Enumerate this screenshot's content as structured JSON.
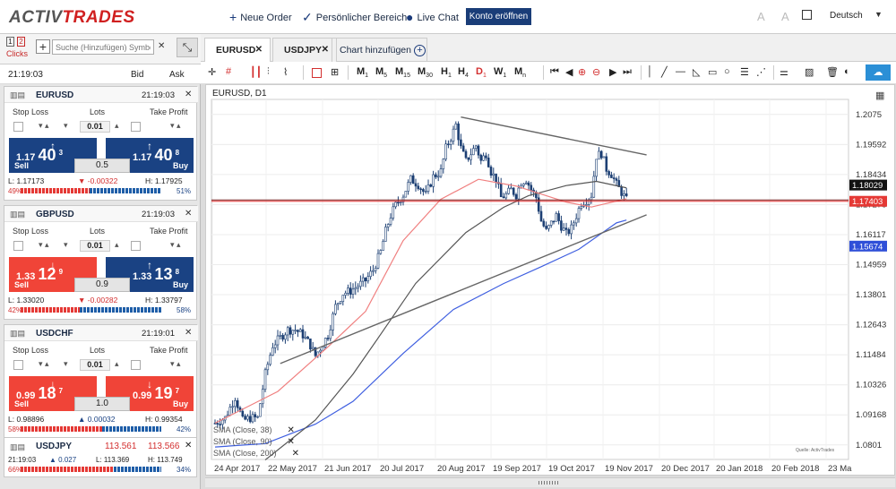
{
  "topbar": {
    "logo_main": "ACTIV",
    "logo_accent": "TRADES",
    "new_order": "Neue Order",
    "personal_area": "Persönlicher Bereich",
    "live_chat": "Live Chat",
    "open_account": "Konto eröffnen",
    "language": "Deutsch"
  },
  "left": {
    "clicks_one": "1",
    "clicks_two": "2",
    "clicks_label": "Clicks",
    "search_placeholder": "Suche (Hinzufügen) Symbol",
    "time": "21:19:03",
    "bid_label": "Bid",
    "ask_label": "Ask",
    "labels": {
      "stop_loss": "Stop Loss",
      "lots": "Lots",
      "take_profit": "Take Profit",
      "sell": "Sell",
      "buy": "Buy"
    },
    "pairs": [
      {
        "name": "EURUSD",
        "time": "21:19:03",
        "lots": "0.01",
        "sell_a": "1.17",
        "sell_b": "40",
        "sell_c": "3",
        "buy_a": "1.17",
        "buy_b": "40",
        "buy_c": "8",
        "spread": "0.5",
        "low": "L: 1.17173",
        "change": "-0.00322",
        "high": "H: 1.17925",
        "pct_sell": "49%",
        "pct_buy": "51%",
        "sell_fraction": 0.49,
        "sell_color": "blue",
        "buy_color": "blue",
        "sell_arrow": "↑",
        "buy_arrow": "↑",
        "change_dir": "down"
      },
      {
        "name": "GBPUSD",
        "time": "21:19:03",
        "lots": "0.01",
        "sell_a": "1.33",
        "sell_b": "12",
        "sell_c": "9",
        "buy_a": "1.33",
        "buy_b": "13",
        "buy_c": "8",
        "spread": "0.9",
        "low": "L: 1.33020",
        "change": "-0.00282",
        "high": "H: 1.33797",
        "pct_sell": "42%",
        "pct_buy": "58%",
        "sell_fraction": 0.42,
        "sell_color": "red",
        "buy_color": "blue",
        "sell_arrow": "↓",
        "buy_arrow": "↑",
        "change_dir": "down"
      },
      {
        "name": "USDCHF",
        "time": "21:19:01",
        "lots": "0.01",
        "sell_a": "0.99",
        "sell_b": "18",
        "sell_c": "7",
        "buy_a": "0.99",
        "buy_b": "19",
        "buy_c": "7",
        "spread": "1.0",
        "low": "L: 0.98896",
        "change": "0.00032",
        "high": "H: 0.99354",
        "pct_sell": "58%",
        "pct_buy": "42%",
        "sell_fraction": 0.58,
        "sell_color": "red",
        "buy_color": "red",
        "sell_arrow": "↓",
        "buy_arrow": "↓",
        "change_dir": "up"
      }
    ],
    "usdjpy": {
      "name": "USDJPY",
      "bid": "113.561",
      "ask": "113.566",
      "time": "21:19:03",
      "change": "0.027",
      "low": "L: 113.369",
      "high": "H: 113.749",
      "pct_sell": "66%",
      "pct_buy": "34%",
      "sell_fraction": 0.66
    }
  },
  "tabs": [
    {
      "label": "EURUSD",
      "active": true
    },
    {
      "label": "USDJPY",
      "active": false
    }
  ],
  "tab_add_label": "Chart hinzufügen",
  "toolbar": {
    "timeframes": [
      {
        "base": "M",
        "sub": "1"
      },
      {
        "base": "M",
        "sub": "5"
      },
      {
        "base": "M",
        "sub": "15"
      },
      {
        "base": "M",
        "sub": "30"
      },
      {
        "base": "H",
        "sub": "1"
      },
      {
        "base": "H",
        "sub": "4"
      },
      {
        "base": "D",
        "sub": "1"
      },
      {
        "base": "W",
        "sub": "1"
      },
      {
        "base": "M",
        "sub": "n"
      }
    ],
    "active_timeframe": "D1"
  },
  "chart": {
    "title": "EURUSD, D1",
    "indicator_labels": [
      "SMA (Close, 38)",
      "SMA (Close, 90)",
      "SMA (Close, 200)"
    ],
    "source_label": "Quelle: ActivTrades",
    "bid_tag": "1.18029",
    "ask_tag": "1.17403",
    "sma200_tag": "1.15674",
    "colors": {
      "up": "#1c3f73",
      "down": "#1c3f73",
      "sma38": "#f08080",
      "sma90": "#555555",
      "sma200": "#3f5fe0",
      "bid_line": "#7a2020",
      "ask_line": "#e03030"
    }
  },
  "chart_data": {
    "type": "candlestick",
    "symbol": "EURUSD",
    "timeframe": "D1",
    "yticks": [
      1.2075,
      1.19592,
      1.18434,
      1.17276,
      1.16117,
      1.14959,
      1.13801,
      1.12643,
      1.11484,
      1.10326,
      1.09168,
      1.0801
    ],
    "ylim": [
      1.0745,
      1.2133
    ],
    "xticks": [
      "24 Apr 2017",
      "22 May 2017",
      "21 Jun 2017",
      "20 Jul 2017",
      "20 Aug 2017",
      "19 Sep 2017",
      "19 Oct 2017",
      "19 Nov 2017",
      "20 Dec 2017",
      "20 Jan 2018",
      "20 Feb 2018",
      "23 Ma"
    ],
    "close_path": [
      [
        0,
        1.0885
      ],
      [
        4,
        1.0905
      ],
      [
        8,
        1.0985
      ],
      [
        11,
        1.0895
      ],
      [
        14,
        1.0905
      ],
      [
        17,
        1.0905
      ],
      [
        20,
        1.1075
      ],
      [
        23,
        1.1185
      ],
      [
        26,
        1.1215
      ],
      [
        29,
        1.1245
      ],
      [
        32,
        1.1245
      ],
      [
        35,
        1.1225
      ],
      [
        38,
        1.1185
      ],
      [
        40,
        1.1145
      ],
      [
        42,
        1.1175
      ],
      [
        45,
        1.1225
      ],
      [
        48,
        1.1335
      ],
      [
        51,
        1.1385
      ],
      [
        54,
        1.1395
      ],
      [
        57,
        1.1415
      ],
      [
        60,
        1.1435
      ],
      [
        63,
        1.1475
      ],
      [
        66,
        1.1545
      ],
      [
        68,
        1.1625
      ],
      [
        70,
        1.1685
      ],
      [
        72,
        1.1725
      ],
      [
        75,
        1.1765
      ],
      [
        78,
        1.1825
      ],
      [
        81,
        1.1805
      ],
      [
        84,
        1.1765
      ],
      [
        87,
        1.1835
      ],
      [
        90,
        1.1855
      ],
      [
        92,
        1.1945
      ],
      [
        94,
        1.1985
      ],
      [
        96,
        1.2035
      ],
      [
        98,
        1.1945
      ],
      [
        100,
        1.1895
      ],
      [
        102,
        1.1925
      ],
      [
        104,
        1.1955
      ],
      [
        106,
        1.1895
      ],
      [
        108,
        1.1925
      ],
      [
        110,
        1.1855
      ],
      [
        112,
        1.1825
      ],
      [
        114,
        1.1755
      ],
      [
        116,
        1.1765
      ],
      [
        118,
        1.1785
      ],
      [
        120,
        1.1765
      ],
      [
        122,
        1.1815
      ],
      [
        124,
        1.1825
      ],
      [
        126,
        1.1785
      ],
      [
        128,
        1.1755
      ],
      [
        130,
        1.1665
      ],
      [
        132,
        1.1625
      ],
      [
        134,
        1.1655
      ],
      [
        136,
        1.1685
      ],
      [
        138,
        1.1645
      ],
      [
        140,
        1.1615
      ],
      [
        142,
        1.1635
      ],
      [
        144,
        1.1685
      ],
      [
        146,
        1.1735
      ],
      [
        148,
        1.1745
      ],
      [
        150,
        1.1765
      ],
      [
        152,
        1.1915
      ],
      [
        154,
        1.1925
      ],
      [
        156,
        1.1865
      ],
      [
        158,
        1.1845
      ],
      [
        160,
        1.1805
      ],
      [
        162,
        1.1775
      ],
      [
        164,
        1.1745
      ]
    ],
    "sma38": [
      [
        0,
        1.0885
      ],
      [
        25,
        1.1007
      ],
      [
        45,
        1.1179
      ],
      [
        60,
        1.1316
      ],
      [
        75,
        1.1589
      ],
      [
        90,
        1.1748
      ],
      [
        105,
        1.1825
      ],
      [
        120,
        1.1799
      ],
      [
        140,
        1.1737
      ],
      [
        150,
        1.1718
      ],
      [
        164,
        1.175
      ]
    ],
    "sma90": [
      [
        20,
        1.0743
      ],
      [
        40,
        1.0897
      ],
      [
        55,
        1.1074
      ],
      [
        65,
        1.1213
      ],
      [
        80,
        1.1424
      ],
      [
        100,
        1.162
      ],
      [
        115,
        1.1717
      ],
      [
        125,
        1.1762
      ],
      [
        140,
        1.1801
      ],
      [
        152,
        1.1817
      ],
      [
        164,
        1.1792
      ]
    ],
    "sma200": [
      [
        0,
        1.0793
      ],
      [
        20,
        1.0806
      ],
      [
        40,
        1.0881
      ],
      [
        55,
        1.0969
      ],
      [
        75,
        1.1154
      ],
      [
        95,
        1.1323
      ],
      [
        115,
        1.1423
      ],
      [
        130,
        1.1488
      ],
      [
        145,
        1.1555
      ],
      [
        160,
        1.1657
      ],
      [
        164,
        1.1668
      ]
    ],
    "trendlines": [
      [
        [
          26,
          1.1115
        ],
        [
          172,
          1.1688
        ]
      ],
      [
        [
          98,
          1.2065
        ],
        [
          172,
          1.1919
        ]
      ]
    ],
    "bid_price": 1.18029,
    "ask_price": 1.17403,
    "sma200_last": 1.15674
  }
}
